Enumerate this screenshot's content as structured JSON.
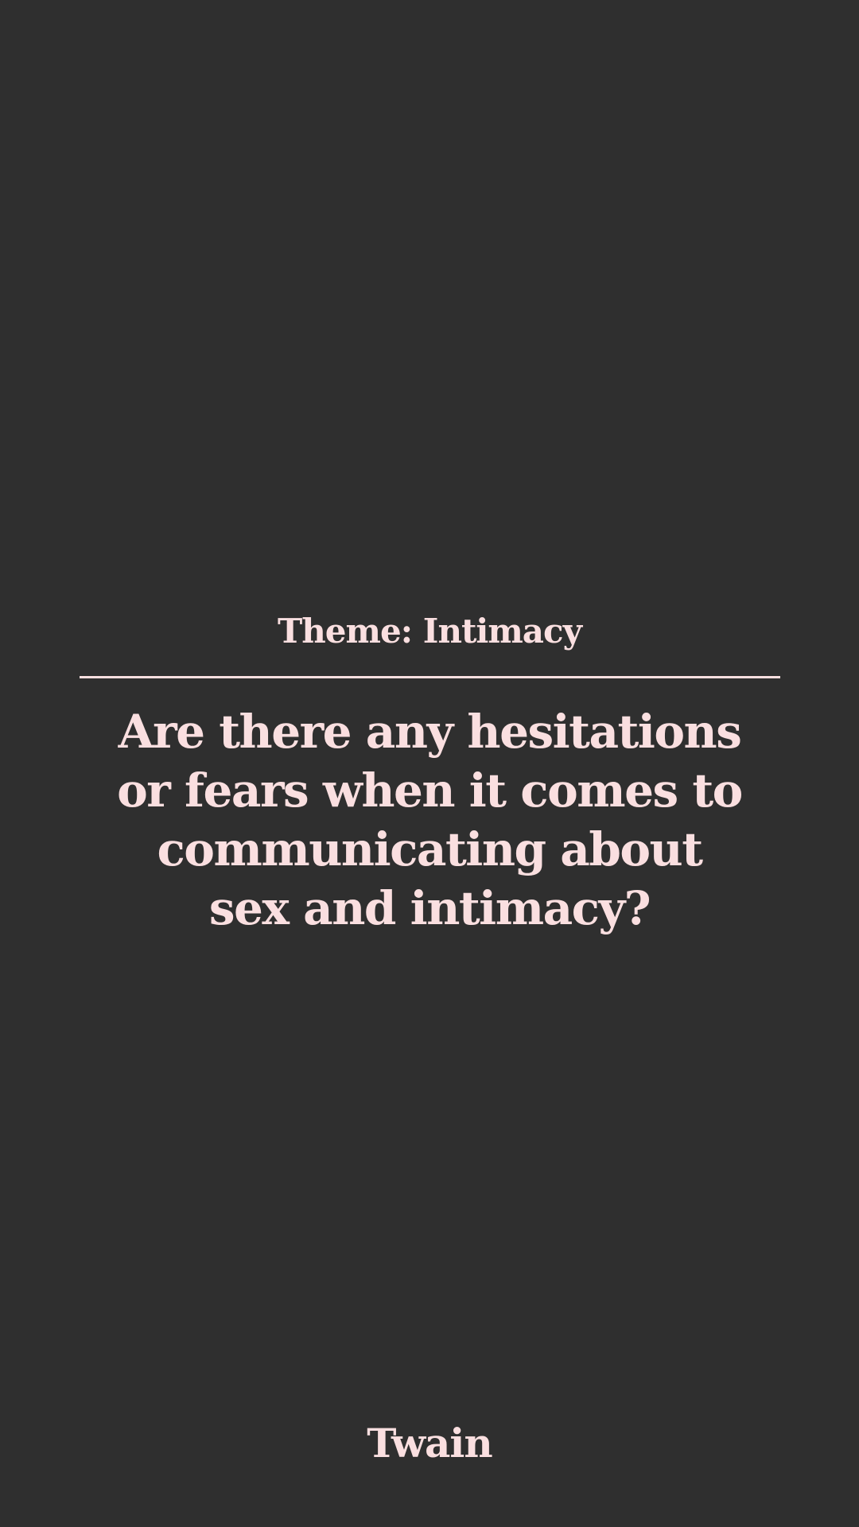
{
  "theme": {
    "label": "Theme: Intimacy"
  },
  "question": {
    "text": "Are there any hesitations or fears when it comes to communicating about sex and intimacy?"
  },
  "brand": {
    "name": "Twain"
  },
  "colors": {
    "background": "#2f2f2f",
    "text": "#fadfe0"
  }
}
